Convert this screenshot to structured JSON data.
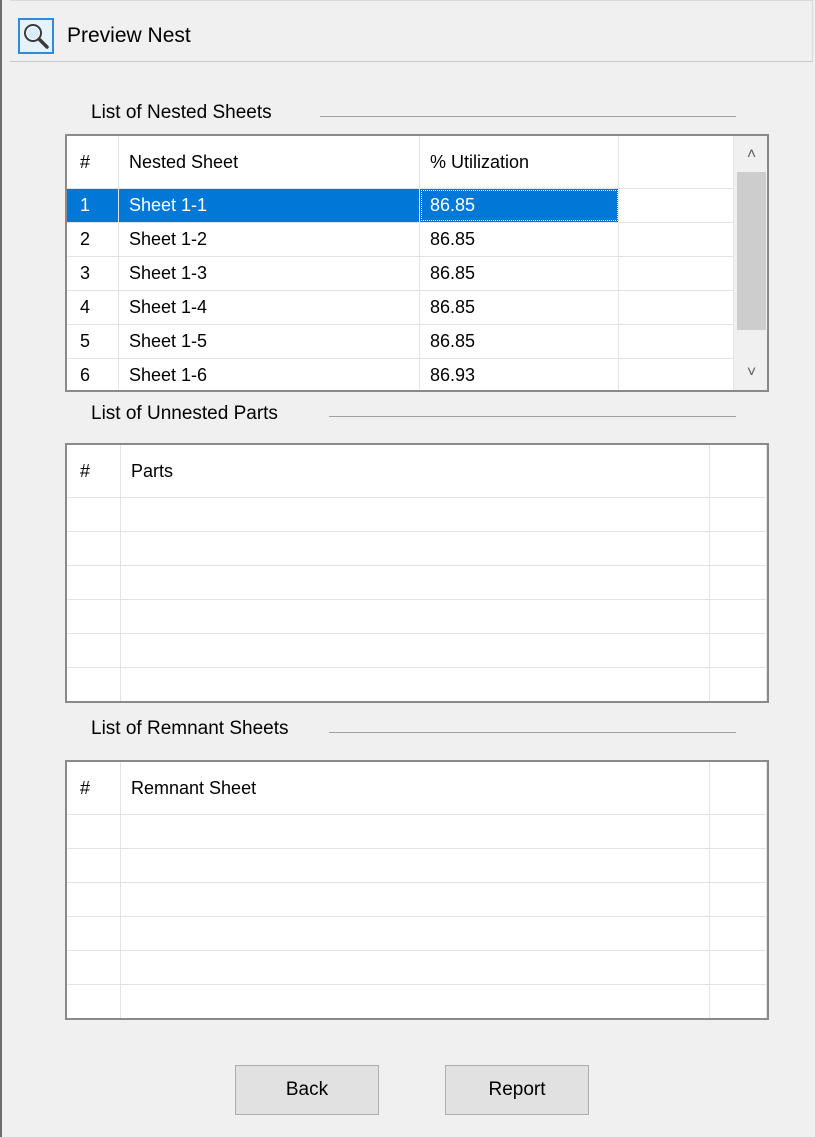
{
  "header": {
    "title": "Preview Nest",
    "icon": "magnifier-icon"
  },
  "nested_sheets": {
    "group_title": "List of Nested Sheets",
    "columns": [
      "#",
      "Nested Sheet",
      "% Utilization"
    ],
    "rows": [
      {
        "num": "1",
        "sheet": "Sheet 1-1",
        "utilization": "86.85",
        "selected": true
      },
      {
        "num": "2",
        "sheet": "Sheet 1-2",
        "utilization": "86.85",
        "selected": false
      },
      {
        "num": "3",
        "sheet": "Sheet 1-3",
        "utilization": "86.85",
        "selected": false
      },
      {
        "num": "4",
        "sheet": "Sheet 1-4",
        "utilization": "86.85",
        "selected": false
      },
      {
        "num": "5",
        "sheet": "Sheet 1-5",
        "utilization": "86.85",
        "selected": false
      },
      {
        "num": "6",
        "sheet": "Sheet 1-6",
        "utilization": "86.93",
        "selected": false
      }
    ],
    "scroll_up_icon": "chevron-up-icon",
    "scroll_down_icon": "chevron-down-icon"
  },
  "unnested_parts": {
    "group_title": "List of Unnested Parts",
    "columns": [
      "#",
      "Parts"
    ],
    "rows": []
  },
  "remnant_sheets": {
    "group_title": "List of Remnant Sheets",
    "columns": [
      "#",
      "Remnant Sheet"
    ],
    "rows": []
  },
  "buttons": {
    "back_label": "Back",
    "report_label": "Report"
  },
  "colors": {
    "selection": "#0078d7",
    "window_bg": "#f0f0f0",
    "icon_border": "#2e8bd8"
  }
}
